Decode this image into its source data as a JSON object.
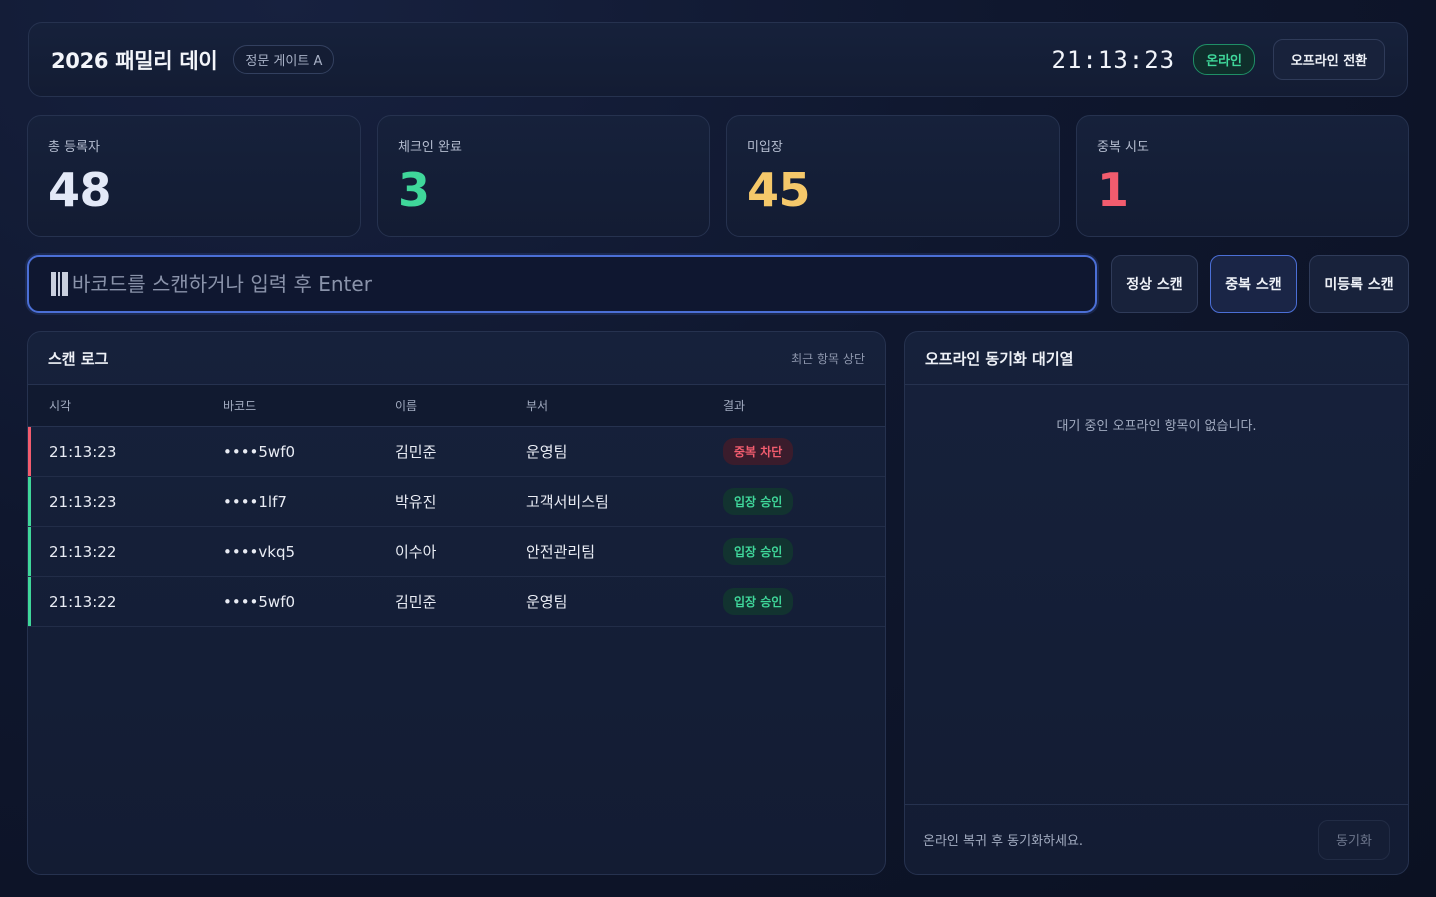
{
  "header": {
    "title": "2026 패밀리 데이",
    "gate": "정문 게이트 A",
    "clock": "21:13:23",
    "status": "온라인",
    "offline_toggle": "오프라인 전환"
  },
  "stats": [
    {
      "label": "총 등록자",
      "value": "48",
      "color": "#e3e9f7"
    },
    {
      "label": "체크인 완료",
      "value": "3",
      "color": "#3fd79a"
    },
    {
      "label": "미입장",
      "value": "45",
      "color": "#f5c86a"
    },
    {
      "label": "중복 시도",
      "value": "1",
      "color": "#f25c6e"
    }
  ],
  "scan": {
    "placeholder": "바코드를 스캔하거나 입력 후 Enter",
    "buttons": [
      "정상 스캔",
      "중복 스캔",
      "미등록 스캔"
    ]
  },
  "log": {
    "title": "스캔 로그",
    "subtitle": "최근 항목 상단",
    "columns": [
      "시각",
      "바코드",
      "이름",
      "부서",
      "결과"
    ],
    "rows": [
      {
        "time": "21:13:23",
        "barcode": "••••5wf0",
        "name": "김민준",
        "dept": "운영팀",
        "result": "중복 차단",
        "status": "blocked"
      },
      {
        "time": "21:13:23",
        "barcode": "••••1lf7",
        "name": "박유진",
        "dept": "고객서비스팀",
        "result": "입장 승인",
        "status": "approved"
      },
      {
        "time": "21:13:22",
        "barcode": "••••vkq5",
        "name": "이수아",
        "dept": "안전관리팀",
        "result": "입장 승인",
        "status": "approved"
      },
      {
        "time": "21:13:22",
        "barcode": "••••5wf0",
        "name": "김민준",
        "dept": "운영팀",
        "result": "입장 승인",
        "status": "approved"
      }
    ]
  },
  "queue": {
    "title": "오프라인 동기화 대기열",
    "empty": "대기 중인 오프라인 항목이 없습니다.",
    "hint": "온라인 복귀 후 동기화하세요.",
    "sync": "동기화"
  },
  "colors": {
    "approved": "#3fd79a",
    "blocked": "#f25c6e",
    "accent": "#4b6fd6"
  }
}
